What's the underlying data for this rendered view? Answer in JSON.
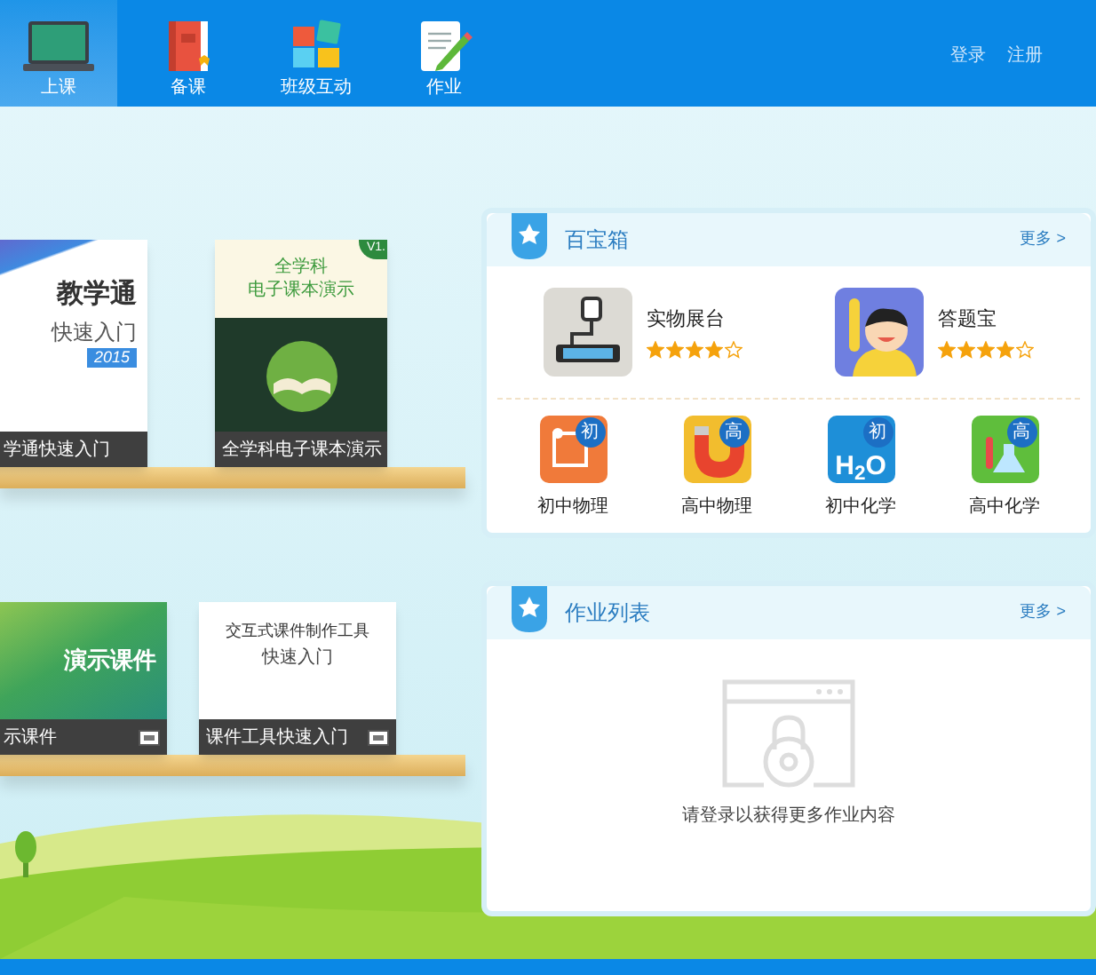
{
  "nav": {
    "tabs": [
      {
        "label": "上课",
        "selected": true,
        "kind": "board"
      },
      {
        "label": "备课",
        "selected": false,
        "kind": "book"
      },
      {
        "label": "班级互动",
        "selected": false,
        "kind": "tiles"
      },
      {
        "label": "作业",
        "selected": false,
        "kind": "paper"
      }
    ],
    "account_links": [
      "登录",
      "注册"
    ]
  },
  "shelves": [
    {
      "books": [
        {
          "kind": "guide",
          "cover_lines": [
            "教学通",
            "快速入门"
          ],
          "badge": "2015",
          "caption": "学通快速入门"
        },
        {
          "kind": "textbook",
          "corner": "V1.",
          "cover_lines": [
            "全学科",
            "电子课本演示"
          ],
          "caption": "全学科电子课本演示"
        }
      ]
    },
    {
      "books": [
        {
          "kind": "slides",
          "cover_lines": [
            "演示课件"
          ],
          "caption": "示课件"
        },
        {
          "kind": "tool",
          "cover_lines": [
            "交互式课件制作工具",
            "快速入门"
          ],
          "caption": "课件工具快速入门"
        }
      ]
    }
  ],
  "toolbox": {
    "title": "百宝箱",
    "more": "更多 >",
    "featured": [
      {
        "name": "实物展台",
        "stars": 4,
        "kind": "projector"
      },
      {
        "name": "答题宝",
        "stars": 4,
        "kind": "kid"
      }
    ],
    "subjects": [
      {
        "label": "初中物理",
        "grade": "初",
        "kind": "circuit"
      },
      {
        "label": "高中物理",
        "grade": "高",
        "kind": "magnet"
      },
      {
        "label": "初中化学",
        "grade": "初",
        "kind": "water",
        "formula": "H$_{2}$O"
      },
      {
        "label": "高中化学",
        "grade": "高",
        "kind": "flask"
      }
    ]
  },
  "homework": {
    "title": "作业列表",
    "more": "更多 >",
    "message": "请登录以获得更多作业内容"
  }
}
